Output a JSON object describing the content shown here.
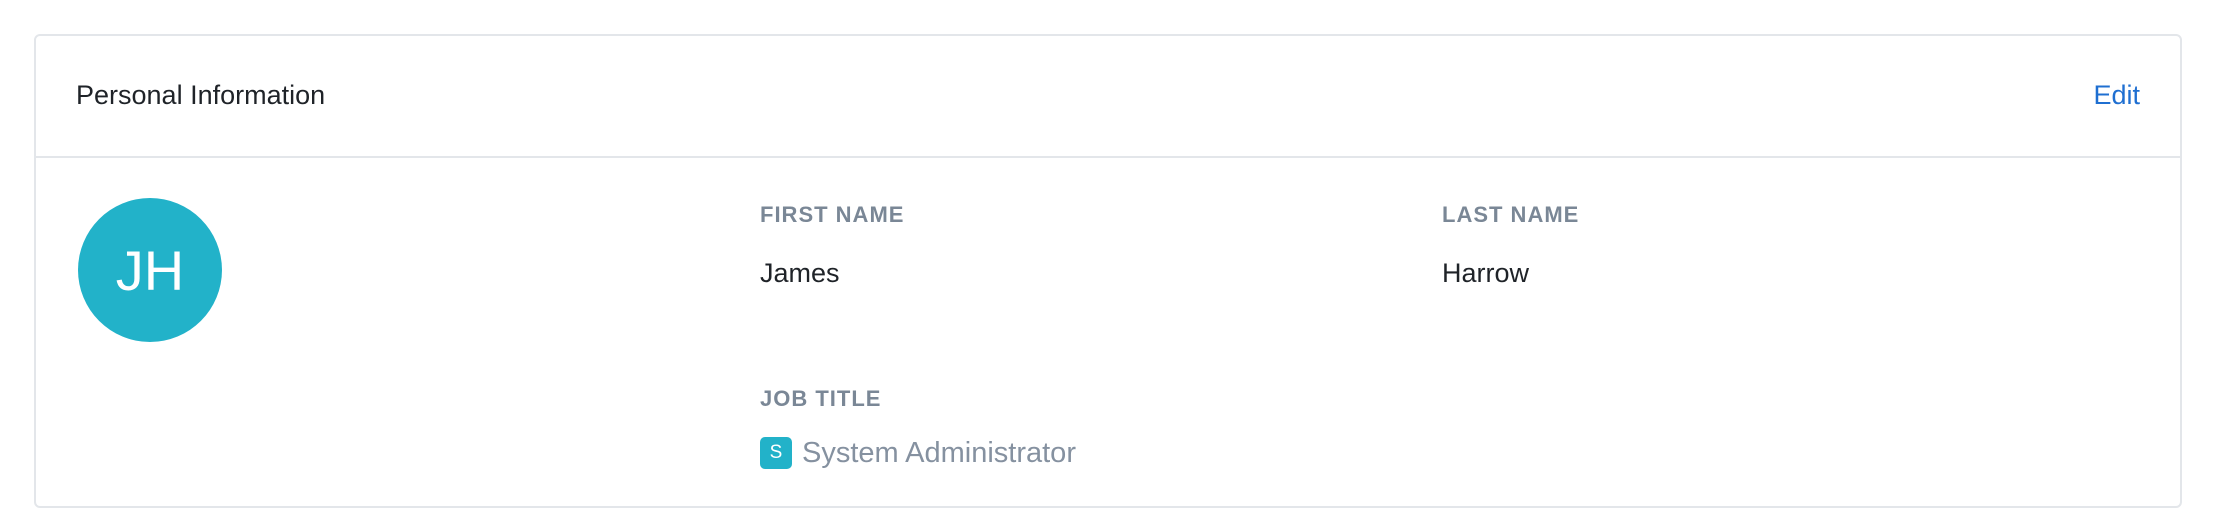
{
  "card": {
    "title": "Personal Information",
    "edit_label": "Edit"
  },
  "avatar": {
    "initials": "JH",
    "color": "#22b2c9"
  },
  "fields": {
    "first_name": {
      "label": "FIRST NAME",
      "value": "James"
    },
    "last_name": {
      "label": "LAST NAME",
      "value": "Harrow"
    },
    "job_title": {
      "label": "JOB TITLE",
      "badge": "S",
      "value": "System Administrator"
    }
  },
  "colors": {
    "accent": "#1f6fd1",
    "avatar_bg": "#22b2c9",
    "label": "#7a8796",
    "border": "#e3e6ea"
  }
}
